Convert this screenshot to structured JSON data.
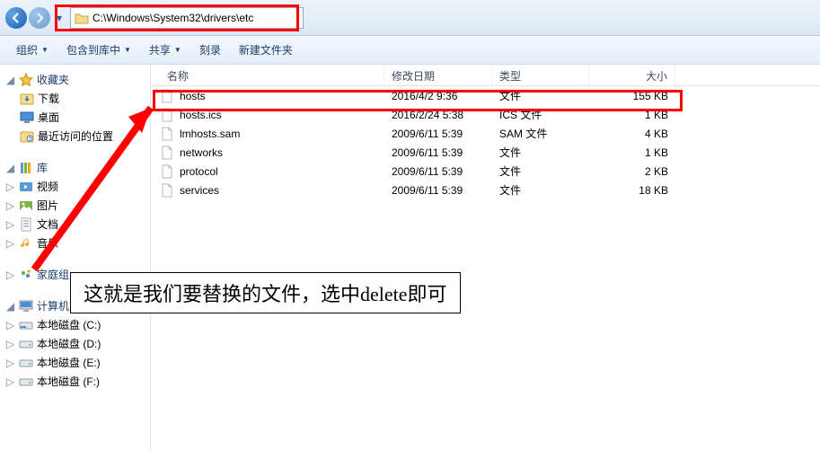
{
  "address": {
    "path": "C:\\Windows\\System32\\drivers\\etc"
  },
  "toolbar": {
    "organize": "组织",
    "include": "包含到库中",
    "share": "共享",
    "burn": "刻录",
    "newfolder": "新建文件夹"
  },
  "sidebar": {
    "favorites": {
      "label": "收藏夹",
      "items": [
        "下载",
        "桌面",
        "最近访问的位置"
      ]
    },
    "libraries": {
      "label": "库",
      "items": [
        "视频",
        "图片",
        "文档",
        "音乐"
      ]
    },
    "homegroup": {
      "label": "家庭组"
    },
    "computer": {
      "label": "计算机",
      "items": [
        "本地磁盘 (C:)",
        "本地磁盘 (D:)",
        "本地磁盘 (E:)",
        "本地磁盘 (F:)"
      ]
    }
  },
  "columns": {
    "name": "名称",
    "date": "修改日期",
    "type": "类型",
    "size": "大小"
  },
  "files": [
    {
      "name": "hosts",
      "date": "2016/4/2 9:36",
      "type": "文件",
      "size": "155 KB"
    },
    {
      "name": "hosts.ics",
      "date": "2016/2/24 5:38",
      "type": "ICS 文件",
      "size": "1 KB"
    },
    {
      "name": "lmhosts.sam",
      "date": "2009/6/11 5:39",
      "type": "SAM 文件",
      "size": "4 KB"
    },
    {
      "name": "networks",
      "date": "2009/6/11 5:39",
      "type": "文件",
      "size": "1 KB"
    },
    {
      "name": "protocol",
      "date": "2009/6/11 5:39",
      "type": "文件",
      "size": "2 KB"
    },
    {
      "name": "services",
      "date": "2009/6/11 5:39",
      "type": "文件",
      "size": "18 KB"
    }
  ],
  "annotation": "这就是我们要替换的文件，选中delete即可"
}
